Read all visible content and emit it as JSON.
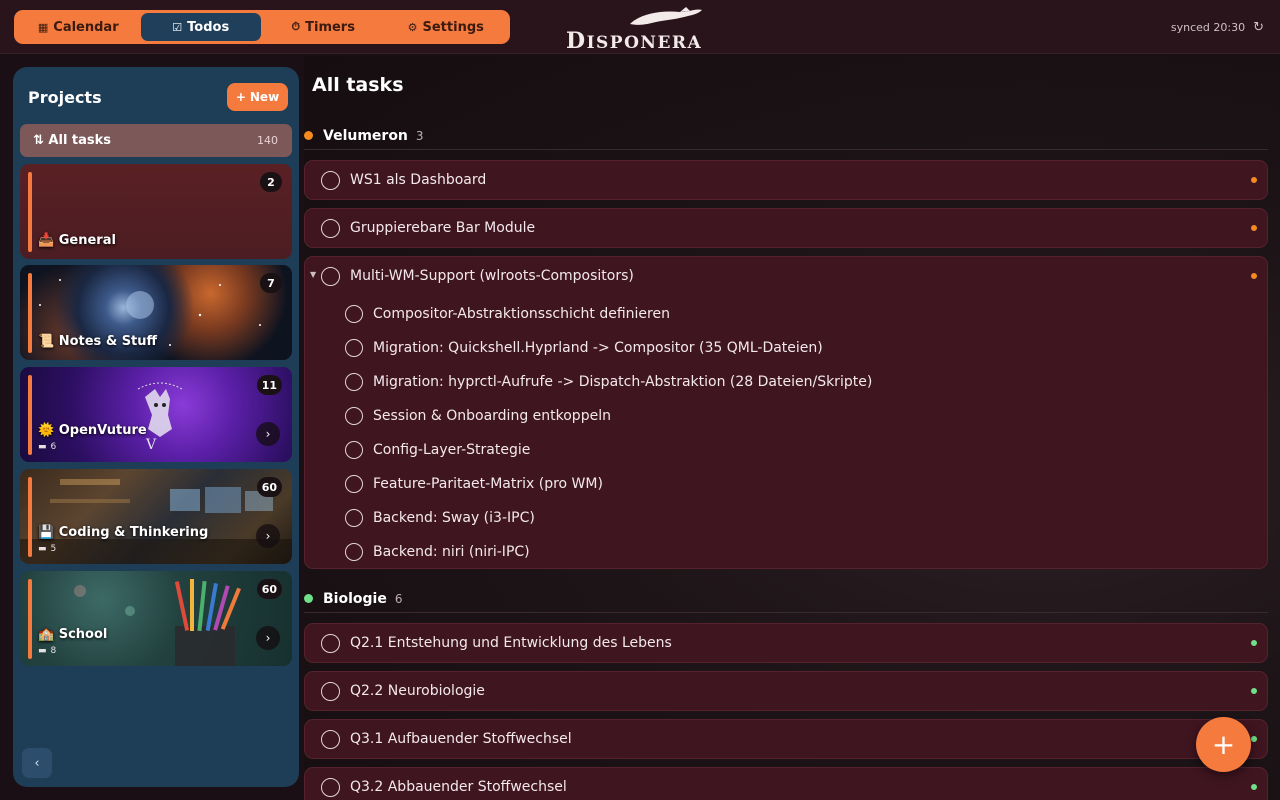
{
  "nav": {
    "tabs": [
      {
        "label": "Calendar",
        "icon": "calendar-icon"
      },
      {
        "label": "Todos",
        "icon": "checkbox-icon"
      },
      {
        "label": "Timers",
        "icon": "stopwatch-icon"
      },
      {
        "label": "Settings",
        "icon": "gear-icon"
      }
    ],
    "active_tab": "Todos"
  },
  "logo": {
    "text_first": "D",
    "text_rest": "ISPONERA"
  },
  "sync": {
    "status": "synced 20:30",
    "icon": "refresh-icon"
  },
  "sidebar": {
    "title": "Projects",
    "new_label": "New",
    "all_tasks": {
      "label": "All tasks",
      "count": "140",
      "icon": "sort-icon"
    },
    "projects": [
      {
        "name": "General",
        "emoji": "📥",
        "count": "2",
        "subprojects": "",
        "color": "#f57a3d"
      },
      {
        "name": "Notes & Stuff",
        "emoji": "📜",
        "count": "7",
        "subprojects": "",
        "color": "#f57a3d"
      },
      {
        "name": "OpenVuture",
        "emoji": "🌞",
        "count": "11",
        "subprojects": "6",
        "color": "#f57a3d"
      },
      {
        "name": "Coding & Thinkering",
        "emoji": "💾",
        "count": "60",
        "subprojects": "5",
        "color": "#f57a3d"
      },
      {
        "name": "School",
        "emoji": "🏫",
        "count": "60",
        "subprojects": "8",
        "color": "#f57a3d"
      }
    ]
  },
  "main": {
    "title": "All tasks",
    "groups": [
      {
        "name": "Velumeron",
        "count": "3",
        "color": "#f58a1f",
        "tasks": [
          {
            "title": "WS1 als Dashboard"
          },
          {
            "title": "Gruppierebare Bar Module"
          },
          {
            "title": "Multi-WM-Support (wlroots-Compositors)",
            "subtasks": [
              "Compositor-Abstraktionsschicht definieren",
              "Migration: Quickshell.Hyprland -> Compositor (35 QML-Dateien)",
              "Migration: hyprctl-Aufrufe -> Dispatch-Abstraktion (28 Dateien/Skripte)",
              "Session & Onboarding entkoppeln",
              "Config-Layer-Strategie",
              "Feature-Paritaet-Matrix (pro WM)",
              "Backend: Sway (i3-IPC)",
              "Backend: niri (niri-IPC)"
            ]
          }
        ]
      },
      {
        "name": "Biologie",
        "count": "6",
        "color": "#6fe08a",
        "tasks": [
          {
            "title": "Q2.1 Entstehung und Entwicklung des Lebens"
          },
          {
            "title": "Q2.2 Neurobiologie"
          },
          {
            "title": "Q3.1 Aufbauender Stoffwechsel"
          },
          {
            "title": "Q3.2 Abbauender Stoffwechsel"
          }
        ]
      }
    ]
  },
  "fab": {
    "label": "+"
  },
  "colors": {
    "accent": "#f57a3d",
    "active_tab": "#1f3f5a",
    "sidebar": "#1e3d57",
    "task_bg": "#3f1520"
  }
}
